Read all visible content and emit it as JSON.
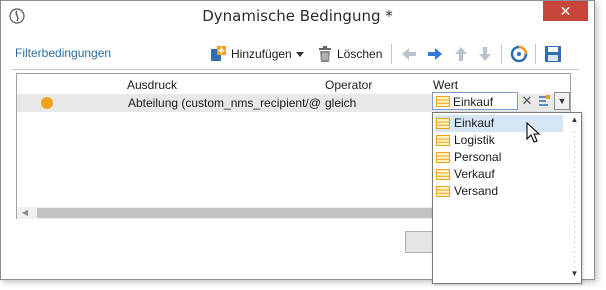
{
  "window": {
    "title": "Dynamische Bedingung *",
    "close_glyph": "✕"
  },
  "toolbar": {
    "filter_label": "Filterbedingungen",
    "add_label": "Hinzufügen",
    "delete_label": "Löschen",
    "icons": [
      "add-icon",
      "dropdown-arrow-icon",
      "trash-icon",
      "arrow-left-icon",
      "arrow-right-icon",
      "arrow-up-icon",
      "arrow-down-icon",
      "refresh-icon",
      "save-icon"
    ]
  },
  "grid": {
    "columns": [
      "Ausdruck",
      "Operator",
      "Wert"
    ],
    "row": {
      "expression": "Abteilung (custom_nms_recipient/@",
      "operator": "gleich",
      "status_color": "#f0a21b"
    }
  },
  "combo": {
    "value": "Einkauf",
    "clear_glyph": "✕",
    "drop_glyph": "▼"
  },
  "dropdown": {
    "items": [
      {
        "label": "Einkauf",
        "selected": true
      },
      {
        "label": "Logistik",
        "selected": false
      },
      {
        "label": "Personal",
        "selected": false
      },
      {
        "label": "Verkauf",
        "selected": false
      },
      {
        "label": "Versand",
        "selected": false
      }
    ],
    "scroll_up": "▲",
    "scroll_down": "▼"
  },
  "colors": {
    "accent_link": "#2b6ca3",
    "close": "#c7453a",
    "selection": "#d6e6f5",
    "table_icon": "#e8a317"
  }
}
